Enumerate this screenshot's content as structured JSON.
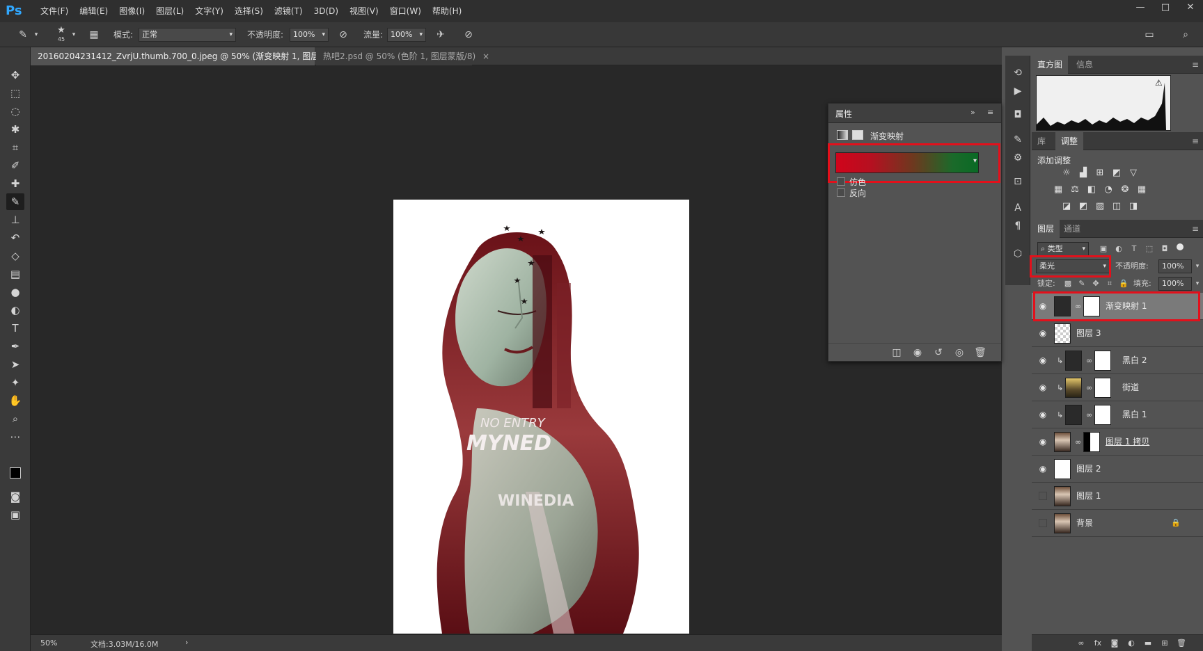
{
  "app": {
    "logo": "Ps"
  },
  "menu": [
    "文件(F)",
    "编辑(E)",
    "图像(I)",
    "图层(L)",
    "文字(Y)",
    "选择(S)",
    "滤镜(T)",
    "3D(D)",
    "视图(V)",
    "窗口(W)",
    "帮助(H)"
  ],
  "window_controls": [
    "—",
    "□",
    "✕"
  ],
  "options": {
    "brush_size": "45",
    "mode_label": "模式:",
    "mode_value": "正常",
    "opacity_label": "不透明度:",
    "opacity_value": "100%",
    "flow_label": "流量:",
    "flow_value": "100%"
  },
  "tabs": [
    {
      "label": "20160204231412_ZvrjU.thumb.700_0.jpeg @ 50% (渐变映射 1, 图层蒙版/8) *",
      "close": "×"
    },
    {
      "label": "热吧2.psd @ 50% (色阶 1, 图层蒙版/8)",
      "close": "×"
    }
  ],
  "status": {
    "zoom": "50%",
    "doc_info": "文档:3.03M/16.0M",
    "arrow": "›"
  },
  "properties": {
    "title": "属性",
    "layer_type": "渐变映射",
    "dither_label": "仿色",
    "reverse_label": "反向",
    "gradient_colors": [
      "#d0041b",
      "#0a6a25"
    ]
  },
  "histogram_panel": {
    "tabs": [
      "直方图",
      "信息"
    ]
  },
  "adjust_panel": {
    "tabs": [
      "库",
      "调整"
    ],
    "add_label": "添加调整"
  },
  "layers_panel": {
    "tabs": [
      "图层",
      "通道"
    ],
    "filter_kind": "类型",
    "blend_mode": "柔光",
    "opacity_label": "不透明度:",
    "opacity_value": "100%",
    "lock_label": "锁定:",
    "fill_label": "填充:",
    "fill_value": "100%",
    "layers": [
      {
        "name": "渐变映射 1",
        "visible": true,
        "selected": true
      },
      {
        "name": "图层 3",
        "visible": true
      },
      {
        "name": "黑白 2",
        "visible": true
      },
      {
        "name": "街道",
        "visible": true
      },
      {
        "name": "黑白 1",
        "visible": true
      },
      {
        "name": "图层 1 拷贝",
        "visible": true
      },
      {
        "name": "图层 2",
        "visible": true
      },
      {
        "name": "图层 1",
        "visible": false
      },
      {
        "name": "背景",
        "visible": false
      }
    ]
  },
  "canvas": {
    "sign_line1": "NO ENTRY",
    "sign_line2": "MYNED",
    "mirror_text": "WINEDIA"
  },
  "colors": {
    "accent_red": "#e3101b",
    "menubar": "#2f2f2f",
    "canvas_bg": "#282828"
  }
}
